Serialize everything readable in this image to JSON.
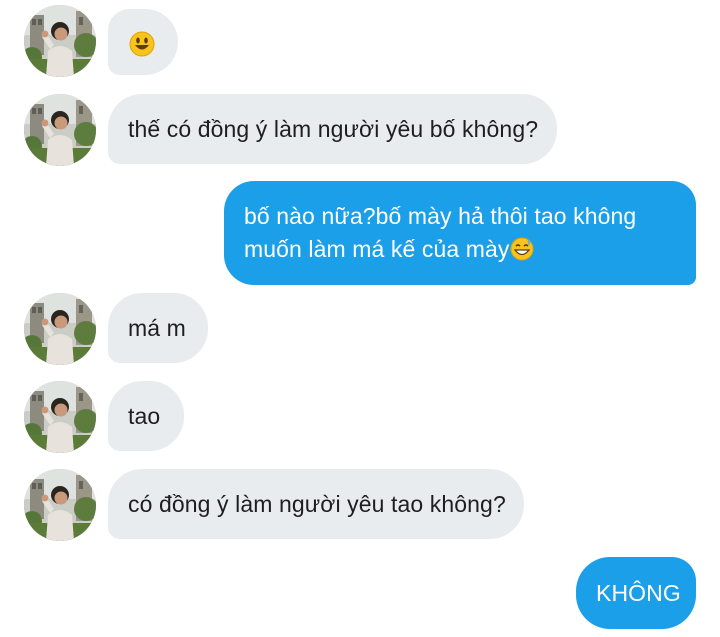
{
  "colors": {
    "incoming_bubble": "#e9ecef",
    "outgoing_bubble": "#1b9fe8",
    "incoming_text": "#1c1e21",
    "outgoing_text": "#ffffff"
  },
  "messages": [
    {
      "direction": "incoming",
      "emoji": "smiley-face-emoji"
    },
    {
      "direction": "incoming",
      "text": "thế có đồng ý làm người yêu bố không?"
    },
    {
      "direction": "outgoing",
      "line1": "bố nào nữa?bố mày hả thôi tao không",
      "line2": "muốn làm má kế của mày",
      "emoji": "grinning-sweat-emoji"
    },
    {
      "direction": "incoming",
      "text": "má m"
    },
    {
      "direction": "incoming",
      "text": "tao"
    },
    {
      "direction": "incoming",
      "text": "có đồng ý làm người yêu tao không?"
    },
    {
      "direction": "outgoing",
      "text": "KHÔNG"
    }
  ]
}
